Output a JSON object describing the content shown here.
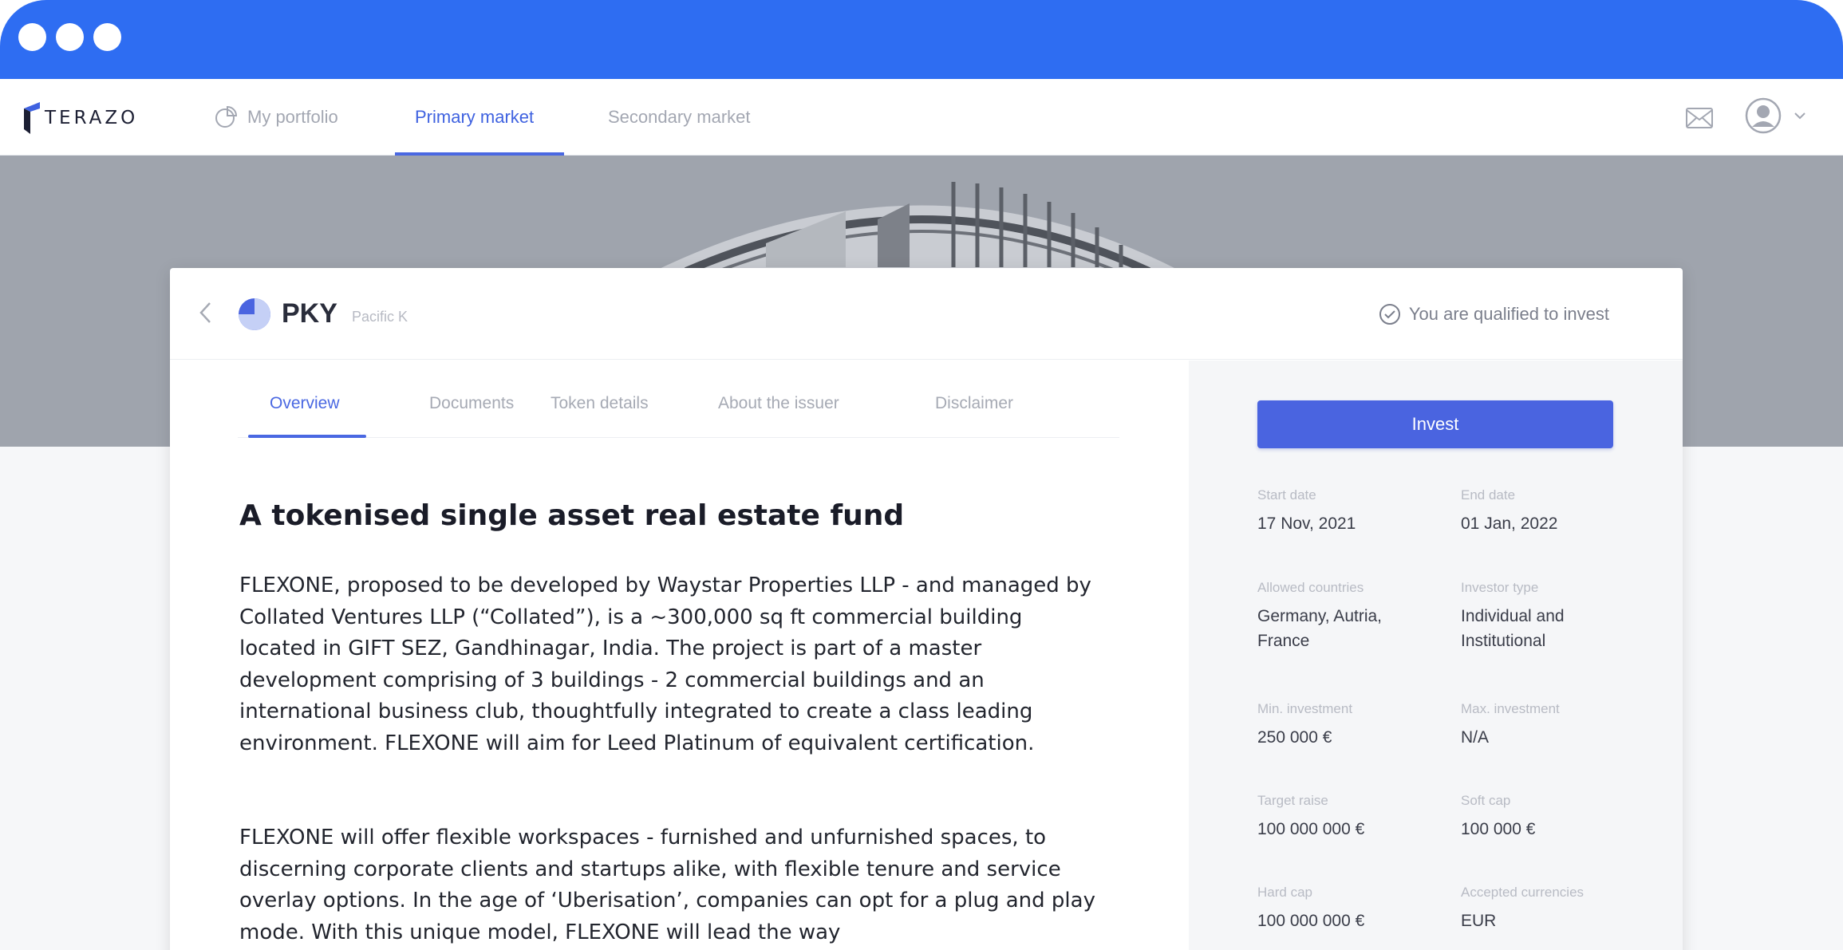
{
  "app": {
    "brand": "TERAZO"
  },
  "nav": {
    "items": [
      {
        "label": "My portfolio",
        "icon": "pie-chart-icon",
        "active": false
      },
      {
        "label": "Primary market",
        "active": true
      },
      {
        "label": "Secondary market",
        "active": false
      }
    ],
    "icons": {
      "mail": "mail-icon",
      "account": "user-icon",
      "dropdown": "chevron-down-icon"
    }
  },
  "token": {
    "ticker": "PKY",
    "issuer": "Pacific K",
    "qualified_text": "You are qualified to invest"
  },
  "tabs": [
    {
      "label": "Overview",
      "active": true
    },
    {
      "label": "Documents",
      "active": false
    },
    {
      "label": "Token details",
      "active": false
    },
    {
      "label": "About the issuer",
      "active": false
    },
    {
      "label": "Disclaimer",
      "active": false
    }
  ],
  "content": {
    "title": "A tokenised single asset real estate fund",
    "paragraphs": [
      "FLEXONE, proposed to be developed by Waystar Properties LLP - and managed by Collated Ventures LLP (“Collated”), is a ~300,000 sq ft commercial building located in GIFT SEZ, Gandhinagar, India. The project is part of a master development comprising of 3 buildings - 2 commercial buildings and an international business club, thoughtfully integrated to create a class leading environment. FLEXONE will aim for  Leed Platinum of equivalent certification.",
      "FLEXONE will offer flexible workspaces - furnished and unfurnished spaces, to discerning corporate clients and startups alike, with flexible tenure and service overlay options. In the age of ‘Uberisation’, companies can opt for a plug and play mode. With this unique model, FLEXONE will lead the way"
    ]
  },
  "sidebar": {
    "invest_label": "Invest",
    "details": [
      {
        "label": "Start date",
        "value": "17 Nov, 2021"
      },
      {
        "label": "End date",
        "value": "01 Jan, 2022"
      },
      {
        "label": "Allowed countries",
        "value": "Germany, Autria, France"
      },
      {
        "label": "Investor type",
        "value": "Individual and Institutional"
      },
      {
        "label": "Min. investment",
        "value": "250 000 €"
      },
      {
        "label": "Max. investment",
        "value": "N/A"
      },
      {
        "label": "Target raise",
        "value": "100 000 000 €"
      },
      {
        "label": "Soft cap",
        "value": "100 000 €"
      },
      {
        "label": "Hard cap",
        "value": "100 000 000 €"
      },
      {
        "label": "Accepted currencies",
        "value": "EUR"
      }
    ]
  },
  "colors": {
    "window_bar": "#2e6df2",
    "accent": "#4a64e0",
    "active_tab": "#3f62e0"
  }
}
